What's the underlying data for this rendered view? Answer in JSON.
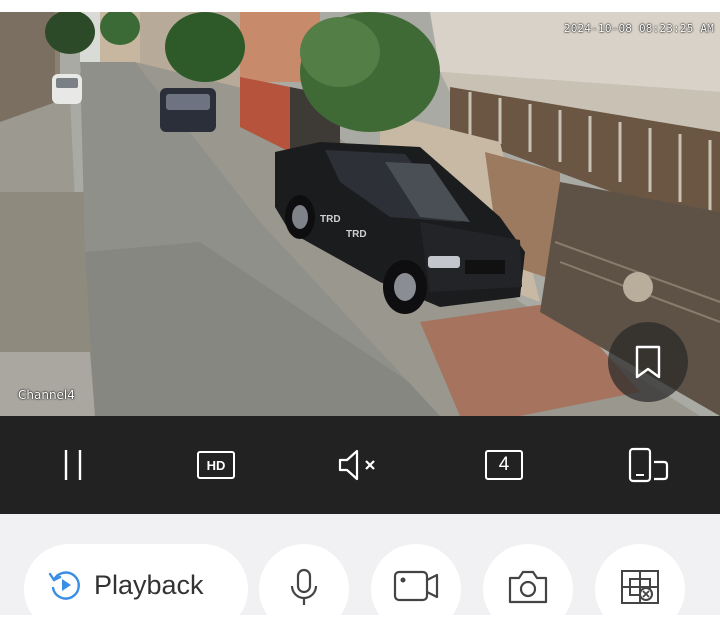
{
  "video": {
    "timestamp": "2024-10-08 08:23:25 AM",
    "channel_label": "Channel4",
    "truck_decal": "TRD"
  },
  "controls": {
    "pause": "pause-icon",
    "quality_label": "HD",
    "audio": "speaker-muted-icon",
    "split_count": "4",
    "orientation": "rotate-screen-icon"
  },
  "actions": {
    "playback_label": "Playback",
    "items": [
      "playback-icon",
      "microphone-icon",
      "record-video-icon",
      "camera-icon",
      "ptz-icon"
    ]
  },
  "colors": {
    "accent": "#3a8ee6",
    "control_bar": "#222222",
    "bottom_bg": "#f1f1f3"
  }
}
